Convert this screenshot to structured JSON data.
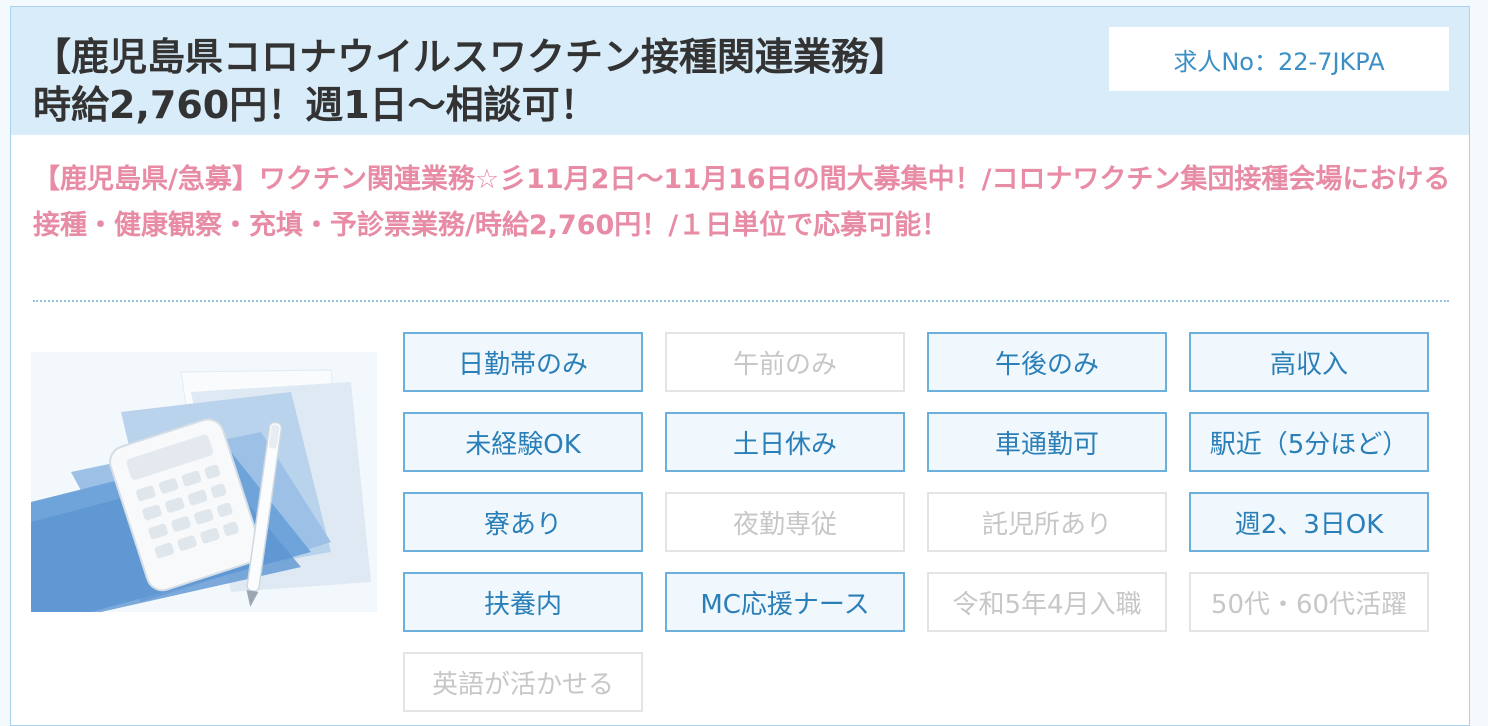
{
  "job": {
    "title_line1": "【鹿児島県コロナウイルスワクチン接種関連業務】",
    "title_line2": "時給2,760円！週1日～相談可！",
    "job_no": "求人No：22-7JKPA",
    "catchcopy": "【鹿児島県/急募】ワクチン関連業務☆彡11月2日〜11月16日の間大募集中！/コロナワクチン集団接種会場における接種・健康観察・充填・予診票業務/時給2,760円！/１日単位で応募可能！"
  },
  "colors": {
    "header_bg": "#d8ecf9",
    "accent_blue": "#2a7fb8",
    "catch_pink": "#e88ba4",
    "tag_inactive_text": "#c7c7c7"
  },
  "thumbnail": {
    "icon": "calculator-documents-photo"
  },
  "tags": [
    {
      "label": "日勤帯のみ",
      "active": true
    },
    {
      "label": "午前のみ",
      "active": false
    },
    {
      "label": "午後のみ",
      "active": true
    },
    {
      "label": "高収入",
      "active": true
    },
    {
      "label": "未経験OK",
      "active": true
    },
    {
      "label": "土日休み",
      "active": true
    },
    {
      "label": "車通勤可",
      "active": true
    },
    {
      "label": "駅近（5分ほど）",
      "active": true
    },
    {
      "label": "寮あり",
      "active": true
    },
    {
      "label": "夜勤専従",
      "active": false
    },
    {
      "label": "託児所あり",
      "active": false
    },
    {
      "label": "週2、3日OK",
      "active": true
    },
    {
      "label": "扶養内",
      "active": true
    },
    {
      "label": "MC応援ナース",
      "active": true
    },
    {
      "label": "令和5年4月入職",
      "active": false
    },
    {
      "label": "50代・60代活躍",
      "active": false
    },
    {
      "label": "英語が活かせる",
      "active": false
    }
  ]
}
